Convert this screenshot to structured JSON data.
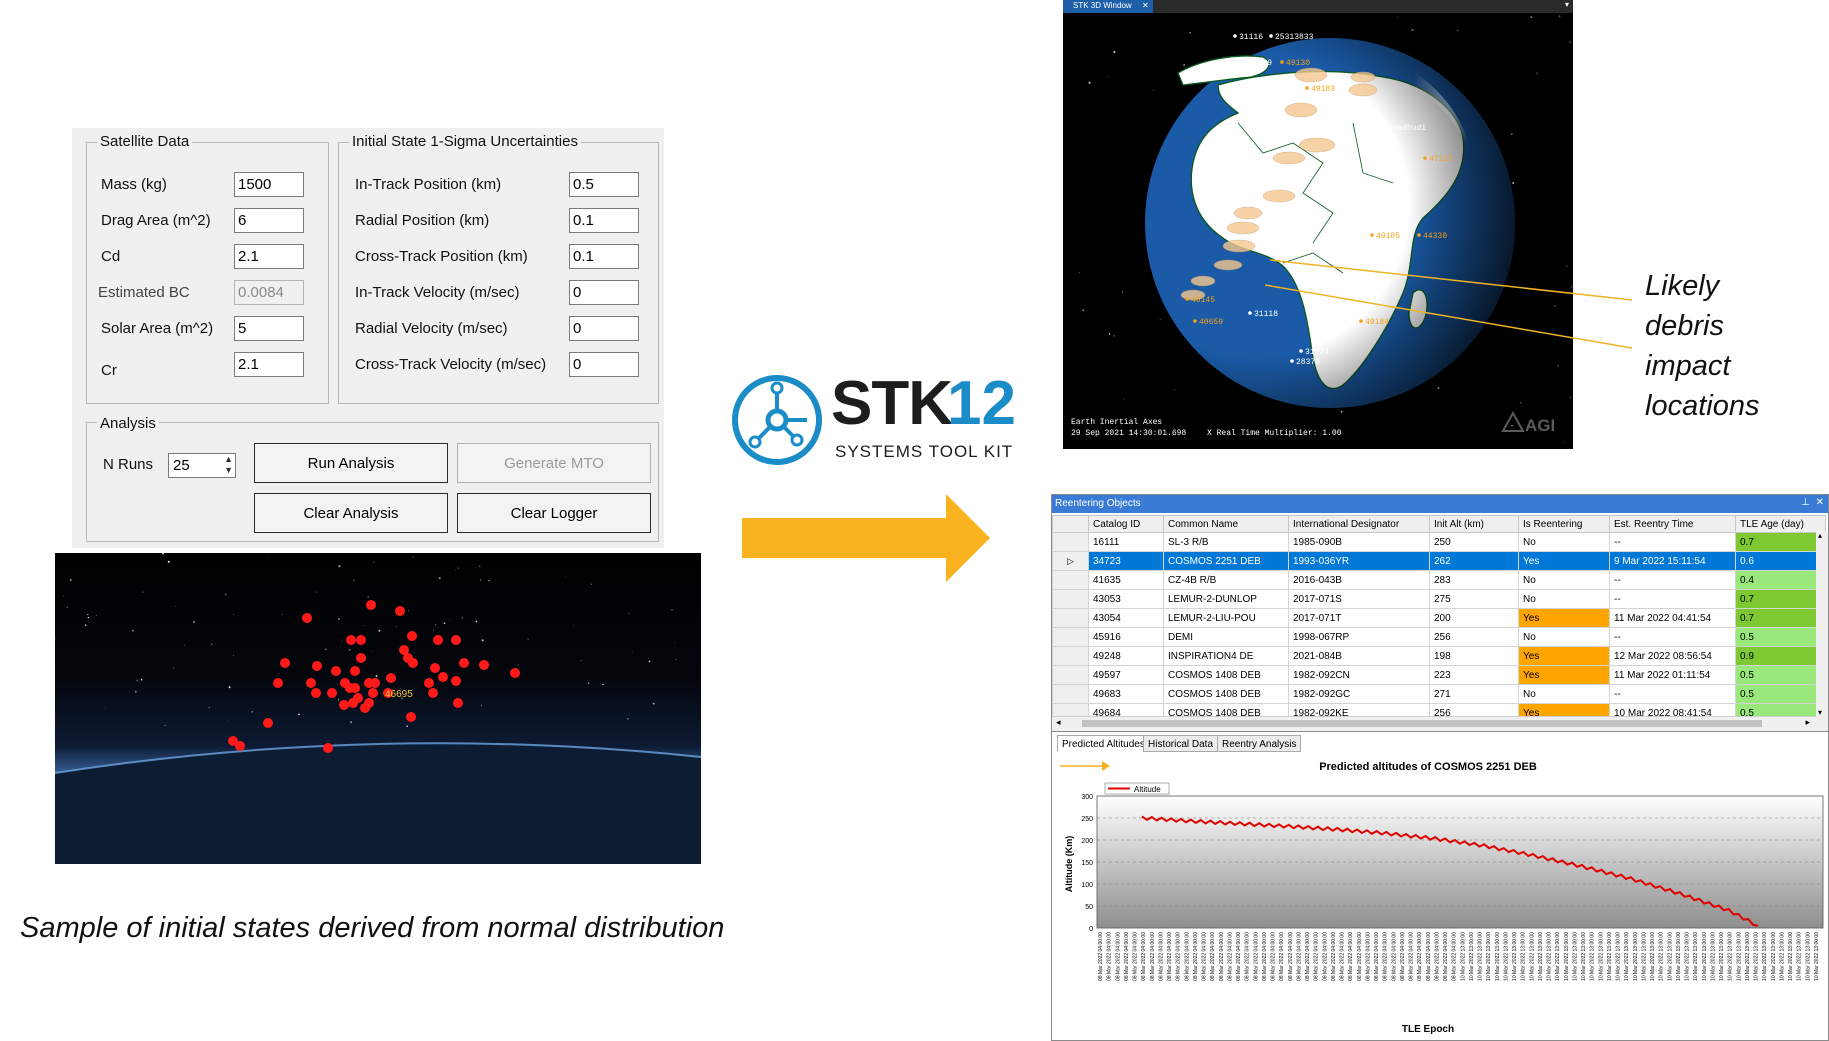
{
  "form": {
    "satellite_group": "Satellite Data",
    "uncertainty_group": "Initial State 1-Sigma Uncertainties",
    "analysis_group": "Analysis",
    "mass_label": "Mass (kg)",
    "mass_value": "1500",
    "drag_area_label": "Drag Area (m^2)",
    "drag_area_value": "6",
    "cd_label": "Cd",
    "cd_value": "2.1",
    "bc_label": "Estimated BC",
    "bc_value": "0.0084",
    "solar_area_label": "Solar Area (m^2)",
    "solar_area_value": "5",
    "cr_label": "Cr",
    "cr_value": "2.1",
    "it_pos_label": "In-Track Position (km)",
    "it_pos_value": "0.5",
    "rad_pos_label": "Radial Position (km)",
    "rad_pos_value": "0.1",
    "ct_pos_label": "Cross-Track Position (km)",
    "ct_pos_value": "0.1",
    "it_vel_label": "In-Track Velocity (m/sec)",
    "it_vel_value": "0",
    "rad_vel_label": "Radial Velocity (m/sec)",
    "rad_vel_value": "0",
    "ct_vel_label": "Cross-Track Velocity (m/sec)",
    "ct_vel_value": "0",
    "nruns_label": "N Runs",
    "nruns_value": "25",
    "run_button": "Run Analysis",
    "mto_button": "Generate MTO",
    "clear_analysis_button": "Clear Analysis",
    "clear_logger_button": "Clear Logger"
  },
  "sample": {
    "marker_label": "46695",
    "caption": "Sample of initial states derived from normal distribution",
    "point_color": "#ff1a1a"
  },
  "logo": {
    "main": "STK",
    "number": "12",
    "sub": "SYSTEMS TOOL KIT",
    "color": "#1a8cc8"
  },
  "stk": {
    "tab_title": "STK 3D Window",
    "close_glyph": "✕",
    "frame_text": "Earth Inertial Axes",
    "time_text": "29 Sep 2021 14:30:01.698",
    "multiplier_text": "X Real Time Multiplier: 1.00",
    "brand": "AGI",
    "labels": [
      {
        "text": "31116"
      },
      {
        "text": "25313833"
      },
      {
        "text": "28369"
      },
      {
        "text": "49130"
      },
      {
        "text": "49183"
      },
      {
        "text": "Rayadhudi"
      },
      {
        "text": "47127"
      },
      {
        "text": "31127"
      },
      {
        "text": "49185"
      },
      {
        "text": "44330"
      },
      {
        "text": "46145"
      },
      {
        "text": "31118"
      },
      {
        "text": "40659"
      },
      {
        "text": "49184"
      },
      {
        "text": "31124"
      },
      {
        "text": "28370"
      }
    ]
  },
  "callout": {
    "line1": "Likely",
    "line2": "debris",
    "line3": "impact",
    "line4": "locations",
    "color": "#f0b323"
  },
  "arrow_color": "#fbb21f",
  "table": {
    "title": "Reentering Objects",
    "pin_glyph": "⊥",
    "close_glyph": "✕",
    "columns": [
      "Catalog ID",
      "Common Name",
      "International Designator",
      "Init Alt (km)",
      "Is Reentering",
      "Est. Reentry Time",
      "TLE Age (day)"
    ],
    "rows": [
      {
        "id": "16111",
        "name": "SL-3 R/B",
        "intl": "1985-090B",
        "alt": "250",
        "reent": "No",
        "time": "--",
        "age": "0.7"
      },
      {
        "id": "34723",
        "name": "COSMOS 2251 DEB",
        "intl": "1993-036YR",
        "alt": "262",
        "reent": "Yes",
        "time": "9 Mar 2022 15:11:54",
        "age": "0.6"
      },
      {
        "id": "41635",
        "name": "CZ-4B R/B",
        "intl": "2016-043B",
        "alt": "283",
        "reent": "No",
        "time": "--",
        "age": "0.4"
      },
      {
        "id": "43053",
        "name": "LEMUR-2-DUNLOP",
        "intl": "2017-071S",
        "alt": "275",
        "reent": "No",
        "time": "--",
        "age": "0.7"
      },
      {
        "id": "43054",
        "name": "LEMUR-2-LIU-POU",
        "intl": "2017-071T",
        "alt": "200",
        "reent": "Yes",
        "time": "11 Mar 2022 04:41:54",
        "age": "0.7"
      },
      {
        "id": "45916",
        "name": "DEMI",
        "intl": "1998-067RP",
        "alt": "256",
        "reent": "No",
        "time": "--",
        "age": "0.5"
      },
      {
        "id": "49248",
        "name": "INSPIRATION4 DE",
        "intl": "2021-084B",
        "alt": "198",
        "reent": "Yes",
        "time": "12 Mar 2022 08:56:54",
        "age": "0.9"
      },
      {
        "id": "49597",
        "name": "COSMOS 1408 DEB",
        "intl": "1982-092CN",
        "alt": "223",
        "reent": "Yes",
        "time": "11 Mar 2022 01:11:54",
        "age": "0.5"
      },
      {
        "id": "49683",
        "name": "COSMOS 1408 DEB",
        "intl": "1982-092GC",
        "alt": "271",
        "reent": "No",
        "time": "--",
        "age": "0.5"
      },
      {
        "id": "49684",
        "name": "COSMOS 1408 DEB",
        "intl": "1982-092KE",
        "alt": "256",
        "reent": "Yes",
        "time": "10 Mar 2022 08:41:54",
        "age": "0.5"
      }
    ],
    "colors": {
      "reentering": "#ffa500",
      "age_high": "#7ec832",
      "age_low": "#98e87c",
      "selected": "#0078d7"
    }
  },
  "tabs": [
    "Predicted Altitudes",
    "Historical Data",
    "Reentry Analysis"
  ],
  "chart_data": {
    "type": "line",
    "title": "Predicted altitudes of COSMOS 2251 DEB",
    "xlabel": "TLE Epoch",
    "ylabel": "Altitude (Km)",
    "legend": "Altitude",
    "legend_position": "top-left",
    "ylim": [
      0,
      300
    ],
    "yticks": [
      0,
      50,
      100,
      150,
      200,
      250,
      300
    ],
    "series_color": "#e00000",
    "x_start_label": "08 Mar 2022 04:00:00",
    "x_end_label": "10 Mar 2022 13:00:00",
    "series": [
      {
        "name": "Altitude",
        "start": [
          0,
          250
        ],
        "waypoints": [
          [
            10,
            243
          ],
          [
            20,
            237
          ],
          [
            30,
            231
          ],
          [
            40,
            224
          ],
          [
            50,
            215
          ],
          [
            60,
            203
          ],
          [
            70,
            187
          ],
          [
            80,
            165
          ],
          [
            90,
            140
          ],
          [
            100,
            112
          ],
          [
            110,
            78
          ],
          [
            120,
            40
          ],
          [
            126,
            5
          ]
        ],
        "oscillation": 7
      }
    ]
  }
}
